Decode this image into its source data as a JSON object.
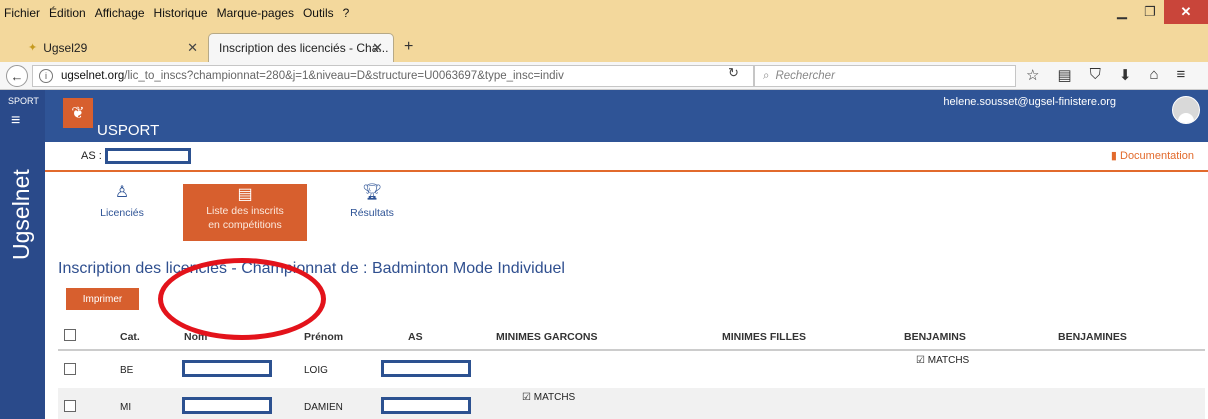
{
  "browser": {
    "menu": [
      "Fichier",
      "Édition",
      "Affichage",
      "Historique",
      "Marque-pages",
      "Outils",
      "?"
    ],
    "tabs": [
      {
        "label": "Ugsel29"
      },
      {
        "label": "Inscription des licenciés - Cha..."
      }
    ],
    "url_domain": "ugselnet.org",
    "url_path": "/lic_to_inscs?championnat=280&j=1&niveau=D&structure=U0063697&type_insc=indiv",
    "search_placeholder": "Rechercher"
  },
  "sidebar": {
    "top_label": "SPORT",
    "vertical_label": "Ugselnet"
  },
  "header": {
    "app_name": "USPORT",
    "email": "helene.sousset@ugsel-finistere.org"
  },
  "as_bar": {
    "label": "AS :",
    "documentation": "Documentation"
  },
  "nav_tiles": {
    "licencies": "Licenciés",
    "liste_line1": "Liste des inscrits",
    "liste_line2": "en compétitions",
    "resultats": "Résultats"
  },
  "main": {
    "title": "Inscription des licencies - Championnat de : Badminton Mode Individuel",
    "print_label": "Imprimer"
  },
  "table": {
    "headers": {
      "cat": "Cat.",
      "nom": "Nom",
      "prenom": "Prénom",
      "as": "AS",
      "minimes_garcons": "MINIMES GARCONS",
      "minimes_filles": "MINIMES FILLES",
      "benjamins": "BENJAMINS",
      "benjamines": "BENJAMINES"
    },
    "rows": [
      {
        "cat": "BE",
        "prenom": "LOIG",
        "benjamins": "MATCHS"
      },
      {
        "cat": "MI",
        "prenom": "DAMIEN",
        "minimes_garcons": "MATCHS"
      }
    ]
  },
  "colors": {
    "primary": "#2f5496",
    "accent": "#d75f2e",
    "annotation": "#e3131b"
  }
}
